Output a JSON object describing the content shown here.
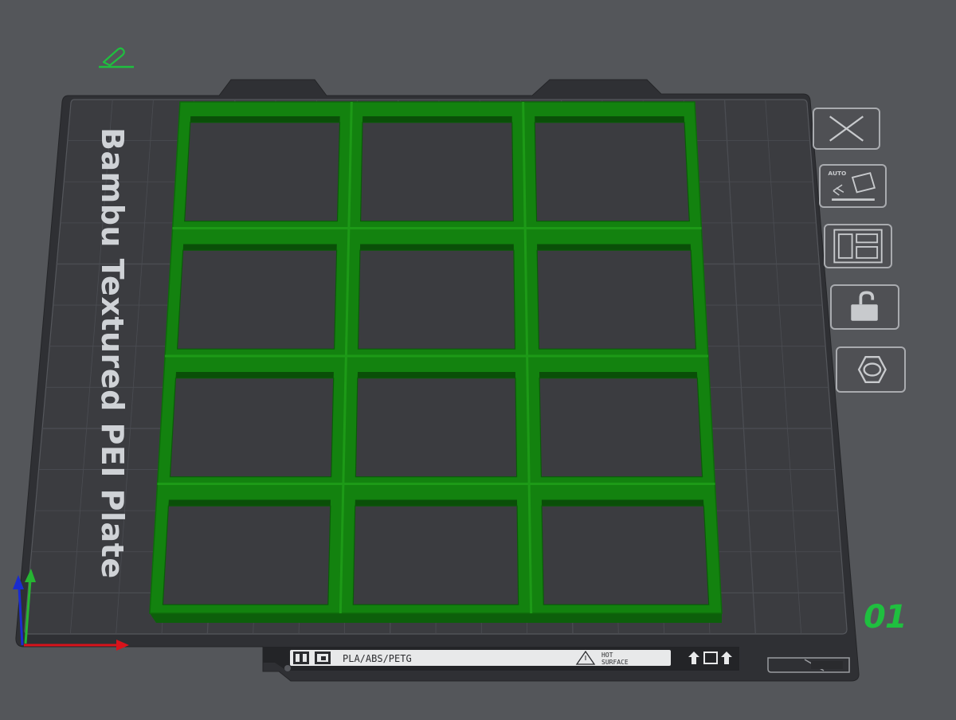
{
  "plate": {
    "name": "Bambu Textured PEI Plate",
    "number": "01",
    "material_label": "PLA/ABS/PETG",
    "hot_surface_line1": "HOT",
    "hot_surface_line2": "SURFACE"
  },
  "toolbar": {
    "auto_label": "AUTO",
    "buttons": [
      {
        "name": "remove-plate-button",
        "icon": "close-icon"
      },
      {
        "name": "auto-orient-button",
        "icon": "auto-orient-icon"
      },
      {
        "name": "arrange-button",
        "icon": "arrange-icon"
      },
      {
        "name": "lock-plate-button",
        "icon": "unlock-icon"
      },
      {
        "name": "plate-settings-button",
        "icon": "hexagon-icon"
      }
    ]
  },
  "model": {
    "color": "#13820f",
    "grid_rows": 4,
    "grid_cols": 3
  },
  "axes": {
    "x_color": "#d8131b",
    "y_color": "#26b532",
    "z_color": "#1a2ccf"
  },
  "colors": {
    "background": "#54565a",
    "plate_frame": "#2f3034",
    "plate_surface": "#3b3c40",
    "accent_green": "#1fbf3f"
  }
}
